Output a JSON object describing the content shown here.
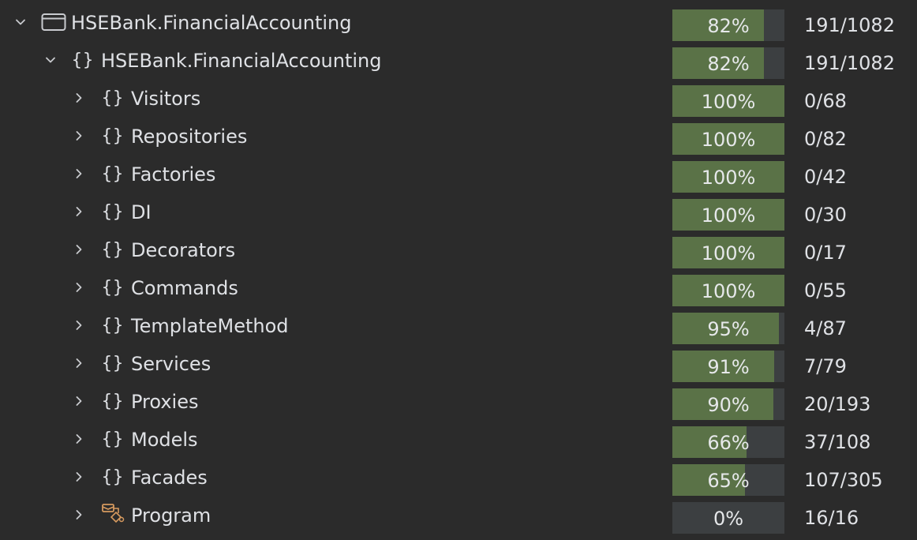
{
  "tree": {
    "rows": [
      {
        "name": "HSEBank.FinancialAccounting",
        "percent_label": "82%",
        "coverage": 0.82,
        "count": "191/1082",
        "icon": "project-window-icon",
        "expanded": true,
        "level": 0
      },
      {
        "name": "HSEBank.FinancialAccounting",
        "percent_label": "82%",
        "coverage": 0.82,
        "count": "191/1082",
        "icon": "namespace-icon",
        "expanded": true,
        "level": 1
      },
      {
        "name": "Visitors",
        "percent_label": "100%",
        "coverage": 1.0,
        "count": "0/68",
        "icon": "namespace-icon",
        "expanded": false,
        "level": 2
      },
      {
        "name": "Repositories",
        "percent_label": "100%",
        "coverage": 1.0,
        "count": "0/82",
        "icon": "namespace-icon",
        "expanded": false,
        "level": 2
      },
      {
        "name": "Factories",
        "percent_label": "100%",
        "coverage": 1.0,
        "count": "0/42",
        "icon": "namespace-icon",
        "expanded": false,
        "level": 2
      },
      {
        "name": "DI",
        "percent_label": "100%",
        "coverage": 1.0,
        "count": "0/30",
        "icon": "namespace-icon",
        "expanded": false,
        "level": 2
      },
      {
        "name": "Decorators",
        "percent_label": "100%",
        "coverage": 1.0,
        "count": "0/17",
        "icon": "namespace-icon",
        "expanded": false,
        "level": 2
      },
      {
        "name": "Commands",
        "percent_label": "100%",
        "coverage": 1.0,
        "count": "0/55",
        "icon": "namespace-icon",
        "expanded": false,
        "level": 2
      },
      {
        "name": "TemplateMethod",
        "percent_label": "95%",
        "coverage": 0.95,
        "count": "4/87",
        "icon": "namespace-icon",
        "expanded": false,
        "level": 2
      },
      {
        "name": "Services",
        "percent_label": "91%",
        "coverage": 0.91,
        "count": "7/79",
        "icon": "namespace-icon",
        "expanded": false,
        "level": 2
      },
      {
        "name": "Proxies",
        "percent_label": "90%",
        "coverage": 0.9,
        "count": "20/193",
        "icon": "namespace-icon",
        "expanded": false,
        "level": 2
      },
      {
        "name": "Models",
        "percent_label": "66%",
        "coverage": 0.66,
        "count": "37/108",
        "icon": "namespace-icon",
        "expanded": false,
        "level": 2
      },
      {
        "name": "Facades",
        "percent_label": "65%",
        "coverage": 0.65,
        "count": "107/305",
        "icon": "namespace-icon",
        "expanded": false,
        "level": 2
      },
      {
        "name": "Program",
        "percent_label": "0%",
        "coverage": 0.0,
        "count": "16/16",
        "icon": "class-program-icon",
        "expanded": false,
        "level": 2
      }
    ]
  },
  "colors": {
    "background": "#2b2b2b",
    "bar_track": "#3c3f41",
    "bar_fill": "#5a7247",
    "text": "#dfe1e5",
    "program_icon": "#d69a5f"
  }
}
